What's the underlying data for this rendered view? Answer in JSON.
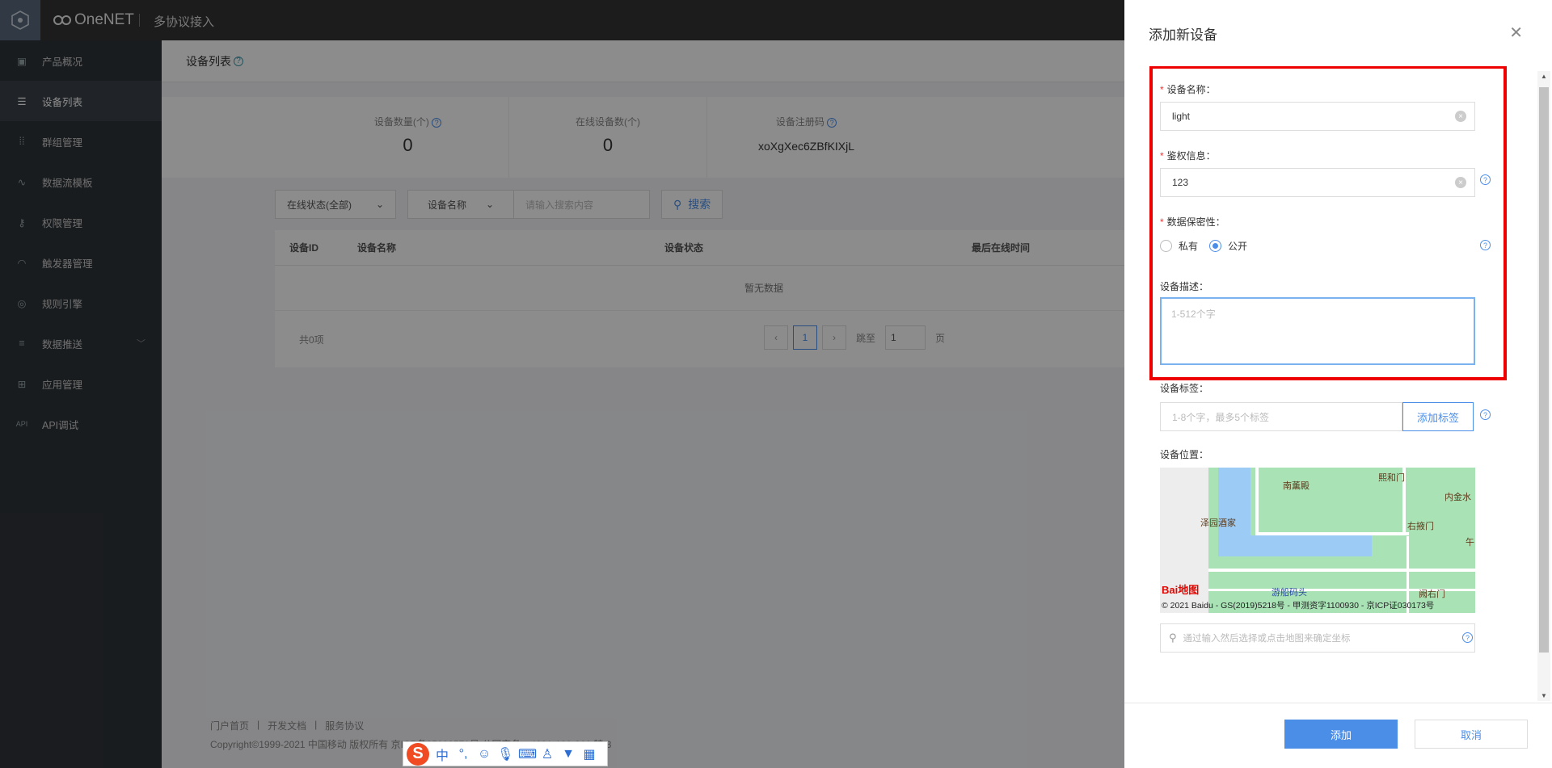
{
  "brand": {
    "name": "OneNET",
    "subtitle": "多协议接入"
  },
  "sidebar": {
    "items": [
      {
        "label": "产品概况",
        "icon": "cube-icon"
      },
      {
        "label": "设备列表",
        "icon": "list-icon"
      },
      {
        "label": "群组管理",
        "icon": "grid-icon"
      },
      {
        "label": "数据流模板",
        "icon": "flow-icon"
      },
      {
        "label": "权限管理",
        "icon": "key-icon"
      },
      {
        "label": "触发器管理",
        "icon": "trigger-icon"
      },
      {
        "label": "规则引擎",
        "icon": "rule-icon"
      },
      {
        "label": "数据推送",
        "icon": "push-icon"
      },
      {
        "label": "应用管理",
        "icon": "app-icon"
      },
      {
        "label": "API调试",
        "icon": "api-icon"
      }
    ]
  },
  "page": {
    "title": "设备列表"
  },
  "stats": {
    "device_count_label": "设备数量(个)",
    "device_count": "0",
    "online_label": "在线设备数(个)",
    "online_count": "0",
    "regcode_label": "设备注册码",
    "regcode": "xoXgXec6ZBfKIXjL"
  },
  "filters": {
    "status": "在线状态(全部)",
    "field": "设备名称",
    "search_placeholder": "请输入搜索内容",
    "search_btn": "搜索"
  },
  "table": {
    "columns": [
      "设备ID",
      "设备名称",
      "设备状态",
      "最后在线时间"
    ],
    "empty": "暂无数据",
    "total": "共0项",
    "page": "1",
    "jump_label": "跳至",
    "jump_value": "1",
    "page_unit": "页"
  },
  "footer": {
    "links": [
      "门户首页",
      "开发文档",
      "服务协议"
    ],
    "copyright": "Copyright©1999-2021 中国移动 版权所有 京ICP备05002571号 公网安备：4001-100-866 转 3"
  },
  "drawer": {
    "title": "添加新设备",
    "name_label": "设备名称：",
    "name_value": "light",
    "auth_label": "鉴权信息：",
    "auth_value": "123",
    "privacy_label": "数据保密性：",
    "private_label": "私有",
    "public_label": "公开",
    "desc_label": "设备描述：",
    "desc_placeholder": "1-512个字",
    "tag_label": "设备标签：",
    "tag_placeholder": "1-8个字，最多5个标签",
    "tag_btn": "添加标签",
    "loc_label": "设备位置：",
    "loc_placeholder": "通过输入然后选择或点击地图来确定坐标",
    "add_btn": "添加",
    "cancel_btn": "取消"
  },
  "map": {
    "pois": [
      "南薰殿",
      "熙和门",
      "内金水",
      "泽园酒家",
      "右掖门",
      "游船码头",
      "阙右门",
      "午"
    ],
    "logo": "Bai地图",
    "copyright": "© 2021 Baidu - GS(2019)5218号 - 甲测资字1100930 - 京ICP证030173号"
  },
  "ime": {
    "logo": "S",
    "mode": "中",
    "punct": "°,"
  }
}
